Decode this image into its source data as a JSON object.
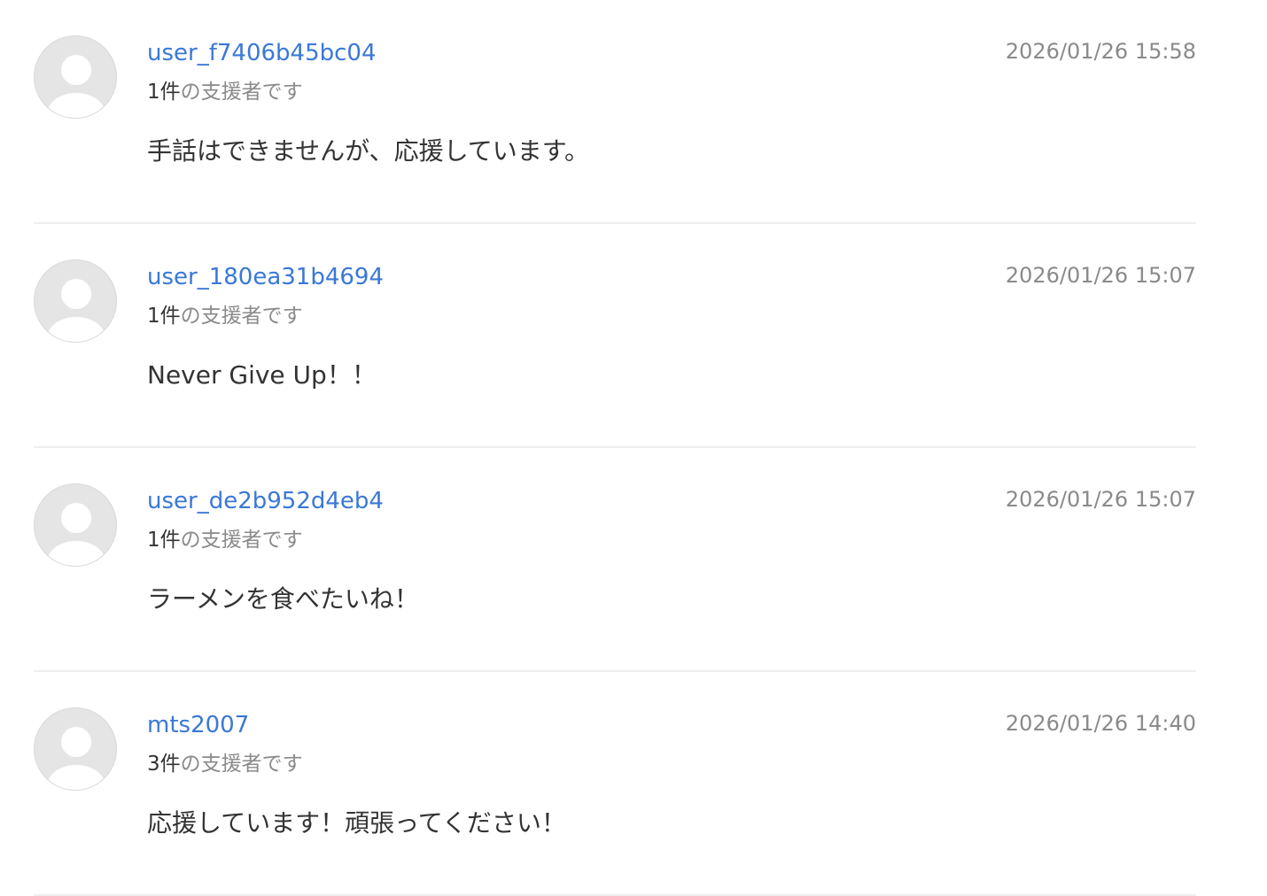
{
  "comments": [
    {
      "username": "user_f7406b45bc04",
      "supporter_count": "1件",
      "supporter_suffix": "の支援者です",
      "timestamp": "2026/01/26 15:58",
      "message": "手話はできませんが、応援しています。"
    },
    {
      "username": "user_180ea31b4694",
      "supporter_count": "1件",
      "supporter_suffix": "の支援者です",
      "timestamp": "2026/01/26 15:07",
      "message": "Never Give Up！！"
    },
    {
      "username": "user_de2b952d4eb4",
      "supporter_count": "1件",
      "supporter_suffix": "の支援者です",
      "timestamp": "2026/01/26 15:07",
      "message": "ラーメンを食べたいね！"
    },
    {
      "username": "mts2007",
      "supporter_count": "3件",
      "supporter_suffix": "の支援者です",
      "timestamp": "2026/01/26 14:40",
      "message": "応援しています！頑張ってください！"
    }
  ],
  "icons": {
    "avatar": "default-user-avatar-icon"
  },
  "colors": {
    "username_link": "#3a78d6",
    "meta_text": "#8a8a8a",
    "body_text": "#333333",
    "avatar_bg": "#e5e5e5",
    "divider": "#eeeeee"
  }
}
